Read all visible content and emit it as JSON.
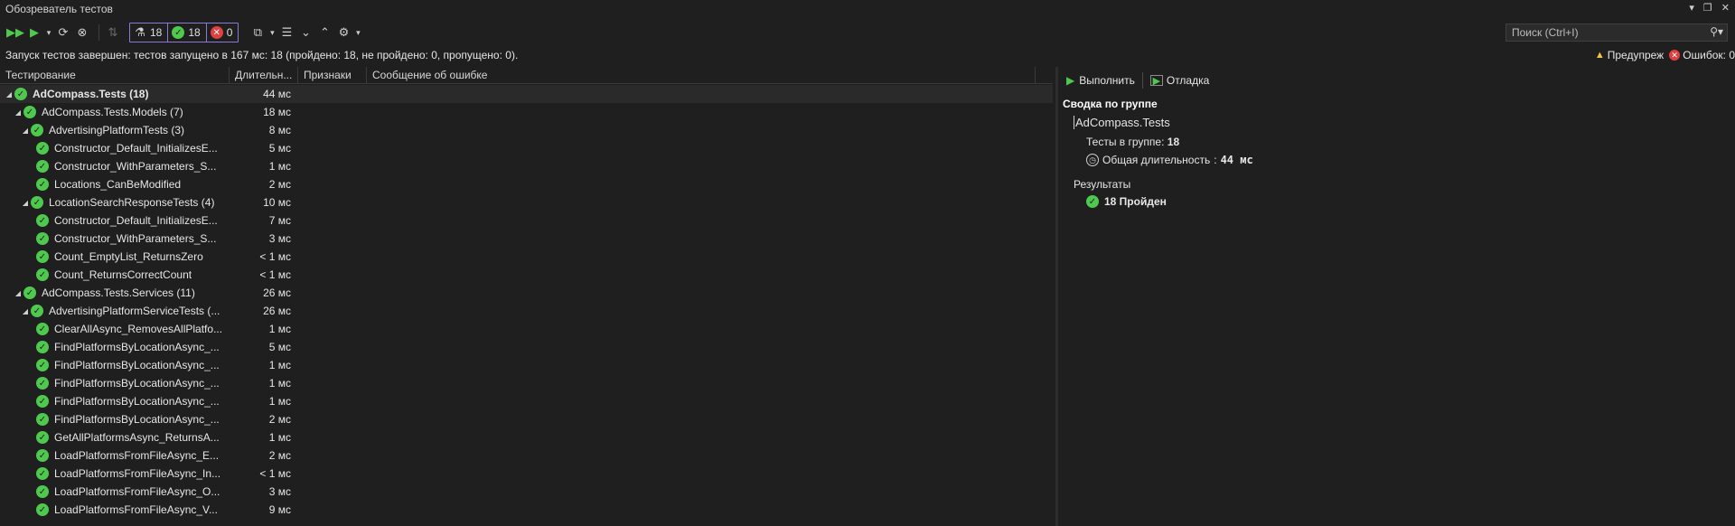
{
  "window": {
    "title": "Обозреватель тестов"
  },
  "toolbar": {
    "total_count": "18",
    "passed_count": "18",
    "failed_count": "0"
  },
  "search": {
    "placeholder": "Поиск (Ctrl+I)"
  },
  "status": {
    "text": "Запуск тестов завершен: тестов запущено в 167 мс: 18 (пройдено: 18, не пройдено: 0, пропущено: 0).",
    "warnings_label": "Предупреж",
    "errors_label": "Ошибок: 0"
  },
  "columns": {
    "test": "Тестирование",
    "duration": "Длительн...",
    "traits": "Признаки",
    "error": "Сообщение об ошибке"
  },
  "rows": [
    {
      "name": "AdCompass.Tests  (18)",
      "duration": "44 мс",
      "level": 0,
      "expander": "◢",
      "selected": true,
      "bold": true
    },
    {
      "name": "AdCompass.Tests.Models  (7)",
      "duration": "18 мс",
      "level": 1,
      "expander": "◢"
    },
    {
      "name": "AdvertisingPlatformTests  (3)",
      "duration": "8 мс",
      "level": 2,
      "expander": "◢"
    },
    {
      "name": "Constructor_Default_InitializesE...",
      "duration": "5 мс",
      "level": 3
    },
    {
      "name": "Constructor_WithParameters_S...",
      "duration": "1 мс",
      "level": 3
    },
    {
      "name": "Locations_CanBeModified",
      "duration": "2 мс",
      "level": 3
    },
    {
      "name": "LocationSearchResponseTests  (4)",
      "duration": "10 мс",
      "level": 2,
      "expander": "◢"
    },
    {
      "name": "Constructor_Default_InitializesE...",
      "duration": "7 мс",
      "level": 3
    },
    {
      "name": "Constructor_WithParameters_S...",
      "duration": "3 мс",
      "level": 3
    },
    {
      "name": "Count_EmptyList_ReturnsZero",
      "duration": "< 1 мс",
      "level": 3
    },
    {
      "name": "Count_ReturnsCorrectCount",
      "duration": "< 1 мс",
      "level": 3
    },
    {
      "name": "AdCompass.Tests.Services  (11)",
      "duration": "26 мс",
      "level": 1,
      "expander": "◢"
    },
    {
      "name": "AdvertisingPlatformServiceTests  (...",
      "duration": "26 мс",
      "level": 2,
      "expander": "◢"
    },
    {
      "name": "ClearAllAsync_RemovesAllPlatfo...",
      "duration": "1 мс",
      "level": 3
    },
    {
      "name": "FindPlatformsByLocationAsync_...",
      "duration": "5 мс",
      "level": 3
    },
    {
      "name": "FindPlatformsByLocationAsync_...",
      "duration": "1 мс",
      "level": 3
    },
    {
      "name": "FindPlatformsByLocationAsync_...",
      "duration": "1 мс",
      "level": 3
    },
    {
      "name": "FindPlatformsByLocationAsync_...",
      "duration": "1 мс",
      "level": 3
    },
    {
      "name": "FindPlatformsByLocationAsync_...",
      "duration": "2 мс",
      "level": 3
    },
    {
      "name": "GetAllPlatformsAsync_ReturnsA...",
      "duration": "1 мс",
      "level": 3
    },
    {
      "name": "LoadPlatformsFromFileAsync_E...",
      "duration": "2 мс",
      "level": 3
    },
    {
      "name": "LoadPlatformsFromFileAsync_In...",
      "duration": "< 1 мс",
      "level": 3
    },
    {
      "name": "LoadPlatformsFromFileAsync_O...",
      "duration": "3 мс",
      "level": 3
    },
    {
      "name": "LoadPlatformsFromFileAsync_V...",
      "duration": "9 мс",
      "level": 3
    }
  ],
  "details": {
    "run_label": "Выполнить",
    "debug_label": "Отладка",
    "heading": "Сводка по группе",
    "group_name": "AdCompass.Tests",
    "tests_in_group_label": "Тесты в группе",
    "tests_in_group_value": "18",
    "total_duration_label": "Общая длительность",
    "total_duration_value": "44 мс",
    "results_heading": "Результаты",
    "passed_result": "18 Пройден"
  }
}
